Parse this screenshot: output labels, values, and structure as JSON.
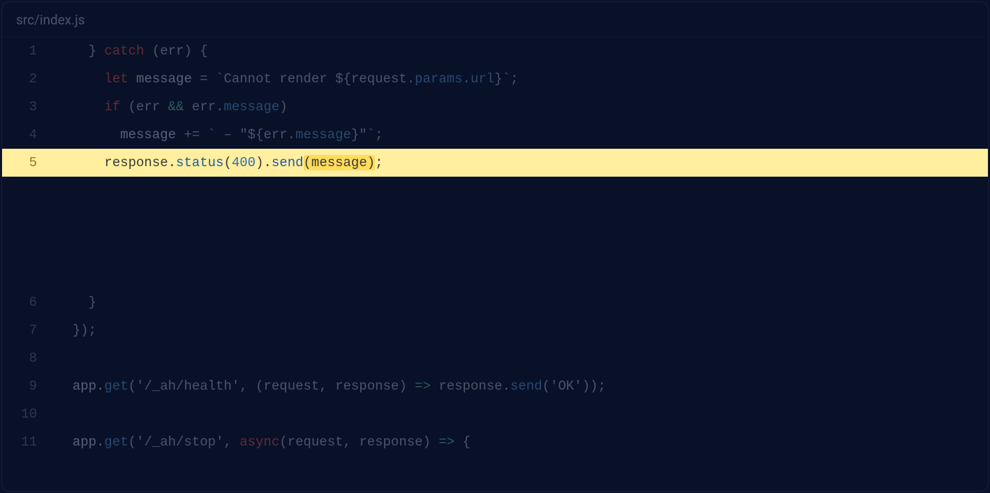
{
  "file": {
    "path": "src/index.js"
  },
  "highlight": {
    "line": 5,
    "mark_text": "(message)"
  },
  "lines": [
    {
      "n": 1,
      "indent": "    ",
      "tokens": [
        [
          "punct",
          "} "
        ],
        [
          "kw-red",
          "catch"
        ],
        [
          "punct",
          " (err) {"
        ]
      ]
    },
    {
      "n": 2,
      "indent": "      ",
      "tokens": [
        [
          "kw-red",
          "let"
        ],
        [
          "ident",
          " message "
        ],
        [
          "punct",
          "= "
        ],
        [
          "str",
          "`Cannot render ${request."
        ],
        [
          "kw-blue",
          "params"
        ],
        [
          "str",
          "."
        ],
        [
          "kw-blue",
          "url"
        ],
        [
          "str",
          "}`"
        ],
        [
          "punct",
          ";"
        ]
      ]
    },
    {
      "n": 3,
      "indent": "      ",
      "tokens": [
        [
          "kw-red",
          "if"
        ],
        [
          "punct",
          " (err "
        ],
        [
          "kw-cyan",
          "&&"
        ],
        [
          "punct",
          " err."
        ],
        [
          "kw-blue",
          "message"
        ],
        [
          "punct",
          ")"
        ]
      ]
    },
    {
      "n": 4,
      "indent": "        ",
      "tokens": [
        [
          "ident",
          "message "
        ],
        [
          "punct",
          "+= "
        ],
        [
          "str",
          "` – \"${err."
        ],
        [
          "kw-blue",
          "message"
        ],
        [
          "str",
          "}\"`"
        ],
        [
          "punct",
          ";"
        ]
      ]
    },
    {
      "n": 5,
      "indent": "      ",
      "hl": true,
      "tokens": [
        [
          "ident",
          "response."
        ],
        [
          "kw-blue",
          "status"
        ],
        [
          "punct",
          "("
        ],
        [
          "num",
          "400"
        ],
        [
          "punct",
          ")."
        ],
        [
          "kw-blue",
          "send"
        ],
        [
          "mark",
          "(message)"
        ],
        [
          "punct",
          ";"
        ]
      ]
    },
    {
      "spacer": true
    },
    {
      "n": 6,
      "indent": "    ",
      "tokens": [
        [
          "punct",
          "}"
        ]
      ]
    },
    {
      "n": 7,
      "indent": "  ",
      "tokens": [
        [
          "punct",
          "});"
        ]
      ]
    },
    {
      "n": 8,
      "indent": "",
      "tokens": []
    },
    {
      "n": 9,
      "indent": "  ",
      "tokens": [
        [
          "ident",
          "app."
        ],
        [
          "kw-blue",
          "get"
        ],
        [
          "punct",
          "("
        ],
        [
          "str",
          "'/_ah/health'"
        ],
        [
          "punct",
          ", (request, response) "
        ],
        [
          "kw-cyan",
          "=>"
        ],
        [
          "punct",
          " response."
        ],
        [
          "kw-blue",
          "send"
        ],
        [
          "punct",
          "("
        ],
        [
          "str",
          "'OK'"
        ],
        [
          "punct",
          "));"
        ]
      ]
    },
    {
      "n": 10,
      "indent": "",
      "tokens": []
    },
    {
      "n": 11,
      "indent": "  ",
      "tokens": [
        [
          "ident",
          "app."
        ],
        [
          "kw-blue",
          "get"
        ],
        [
          "punct",
          "("
        ],
        [
          "str",
          "'/_ah/stop'"
        ],
        [
          "punct",
          ", "
        ],
        [
          "kw-red",
          "async"
        ],
        [
          "punct",
          "(request, response) "
        ],
        [
          "kw-cyan",
          "=>"
        ],
        [
          "punct",
          " {"
        ]
      ]
    }
  ]
}
